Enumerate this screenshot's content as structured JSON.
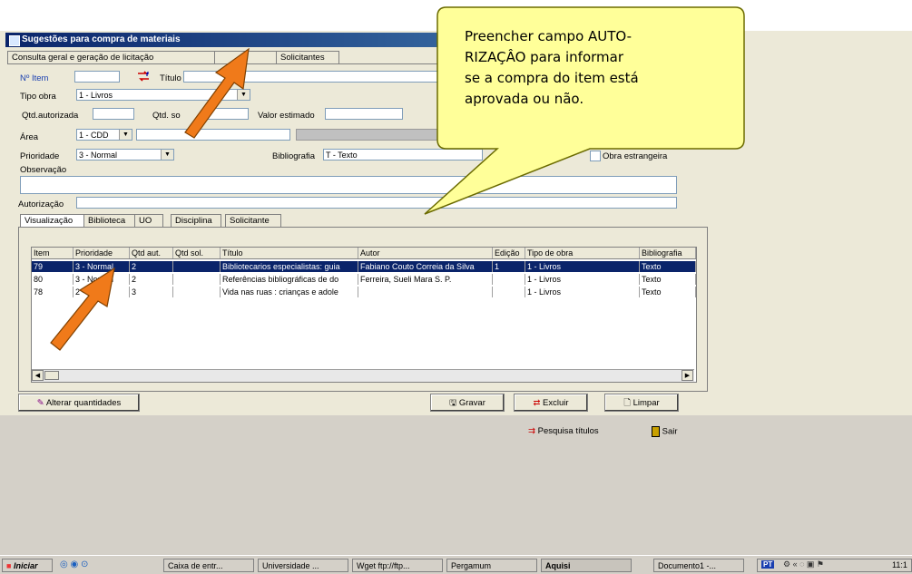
{
  "window": {
    "title": "Sugestões para compra de materiais"
  },
  "top_tabs": [
    "Consulta geral e geração de licitação",
    "",
    "Solicitantes"
  ],
  "form": {
    "item_label": "Nº Item",
    "titulo_label": "Título",
    "tipo_obra_label": "Tipo obra",
    "tipo_obra_value": "1 - Livros",
    "qtd_autorizada_label": "Qtd.autorizada",
    "qtd_sol_label": "Qtd. so",
    "valor_estimado_label": "Valor estimado",
    "area_label": "Área",
    "area_value": "1 - CDD",
    "prioridade_label": "Prioridade",
    "prioridade_value": "3 - Normal",
    "bibliografia_label": "Bibliografia",
    "bibliografia_value": "T - Texto",
    "obra_estrangeira_label": "Obra estrangeira",
    "observacao_label": "Observação",
    "autorizacao_label": "Autorização"
  },
  "sub_tabs": [
    "Visualização",
    "Biblioteca",
    "UO",
    "Disciplina",
    "Solicitante"
  ],
  "table": {
    "headers": [
      "Item",
      "Prioridade",
      "Qtd aut.",
      "Qtd sol.",
      "Título",
      "Autor",
      "Edição",
      "Tipo de obra",
      "Bibliografia"
    ],
    "rows": [
      [
        "79",
        "3 - Normal",
        "2",
        "",
        "Bibliotecarios especialistas: guia",
        "Fabiano Couto Correia da Silva",
        "1",
        "1 - Livros",
        "Texto"
      ],
      [
        "80",
        "3 - Normal",
        "2",
        "",
        "Referências bibliográficas de do",
        "Ferreira, Sueli Mara S. P.",
        "",
        "1 - Livros",
        "Texto"
      ],
      [
        "78",
        "2 -",
        "3",
        "",
        "Vida nas ruas : crianças e adole",
        "",
        "",
        "1 - Livros",
        "Texto"
      ]
    ]
  },
  "buttons": {
    "alterar": "Alterar quantidades",
    "gravar": "Gravar",
    "excluir": "Excluir",
    "limpar": "Limpar",
    "pesquisa": "Pesquisa títulos",
    "sair": "Sair"
  },
  "callout": {
    "lines": [
      "Preencher campo AUTO-",
      "RIZAÇÂO para informar",
      "se a compra do item está",
      "aprovada ou não."
    ]
  },
  "taskbar": {
    "start": "Iniciar",
    "items": [
      "Caixa de entr...",
      "Universidade ...",
      "Wget ftp://ftp...",
      "Pergamum",
      "Aquisi",
      "Documento1 -..."
    ],
    "lang": "PT",
    "clock": "11:1"
  },
  "colors": {
    "title_bar": "#0a246a",
    "callout_fill": "#ffff99",
    "arrow": "#f07a1a",
    "selected_row": "#0a246a"
  }
}
